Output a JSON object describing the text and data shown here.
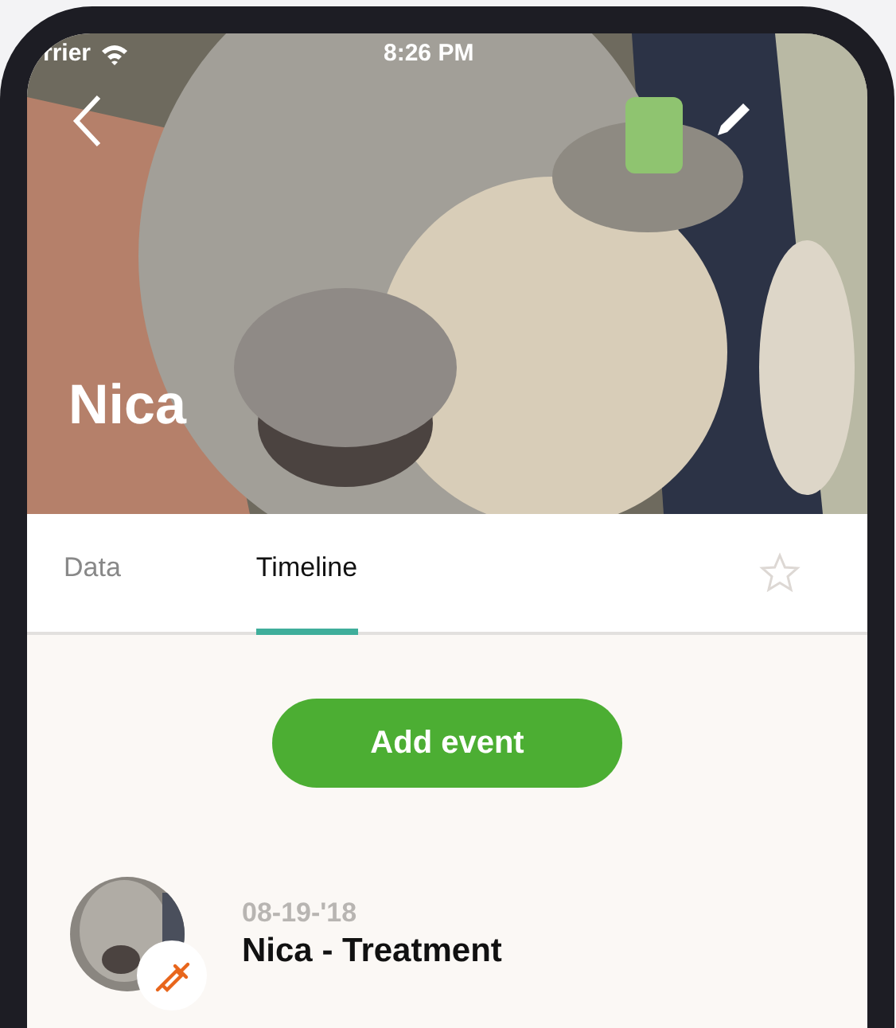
{
  "status_bar": {
    "carrier": "rrier",
    "time": "8:26 PM"
  },
  "header": {
    "title": "Nica",
    "kind": "picture"
  },
  "tabs": [
    {
      "label": "Data",
      "selected": false
    },
    {
      "label": "Timeline",
      "selected": true
    }
  ],
  "favorite": {
    "on": false
  },
  "add_button": {
    "label": "Add event"
  },
  "events": [
    {
      "date": "08-19-'18",
      "title": "Nica - Treatment",
      "kind": "treatment"
    }
  ]
}
